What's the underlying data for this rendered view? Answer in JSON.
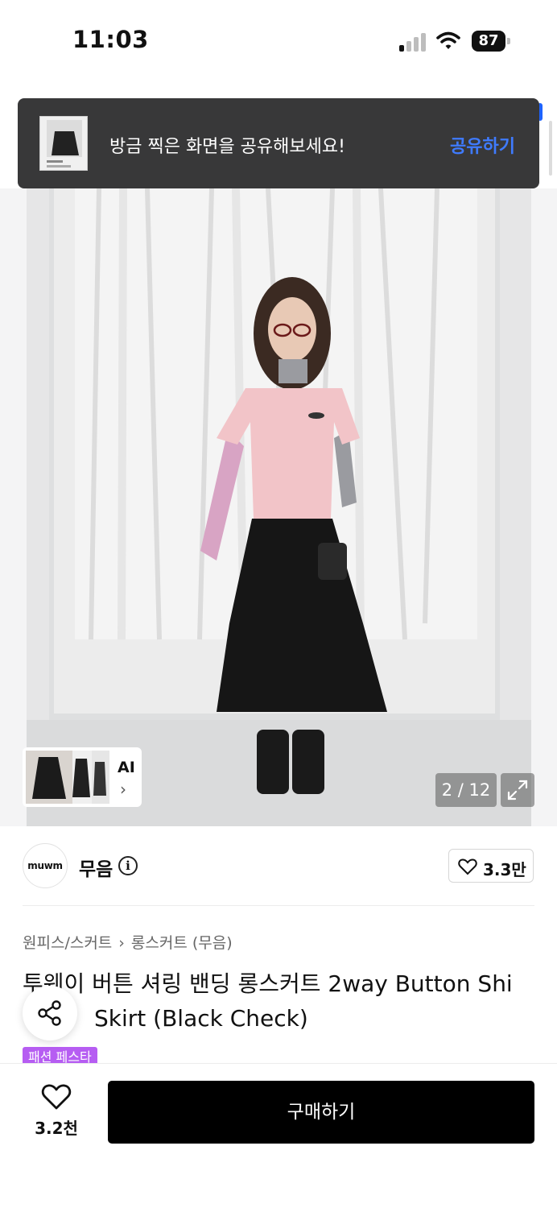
{
  "status_bar": {
    "time": "11:03",
    "battery": "87"
  },
  "toast": {
    "message": "방금 찍은 화면을 공유해보세요!",
    "action": "공유하기"
  },
  "gallery": {
    "ai_label": "AI",
    "ai_chevron": "›",
    "counter": "2 / 12"
  },
  "brand": {
    "logo_text": "muwm",
    "name": "무음",
    "info_glyph": "i",
    "likes": "3.3만"
  },
  "breadcrumb": {
    "category": "원피스/스커트",
    "separator": "›",
    "subcategory": "롱스커트 (무음)"
  },
  "product": {
    "title": "투웨이 버튼 셔링 밴딩 롱스커트 2way Button Shi\n          Skirt (Black Check)",
    "badge": "패션 페스타"
  },
  "bottom_bar": {
    "wish_count": "3.2천",
    "buy_label": "구매하기"
  },
  "colors": {
    "accent": "#3f7bff",
    "toast_bg": "#383839",
    "badge": "#b65df2",
    "buy_bg": "#000000"
  }
}
